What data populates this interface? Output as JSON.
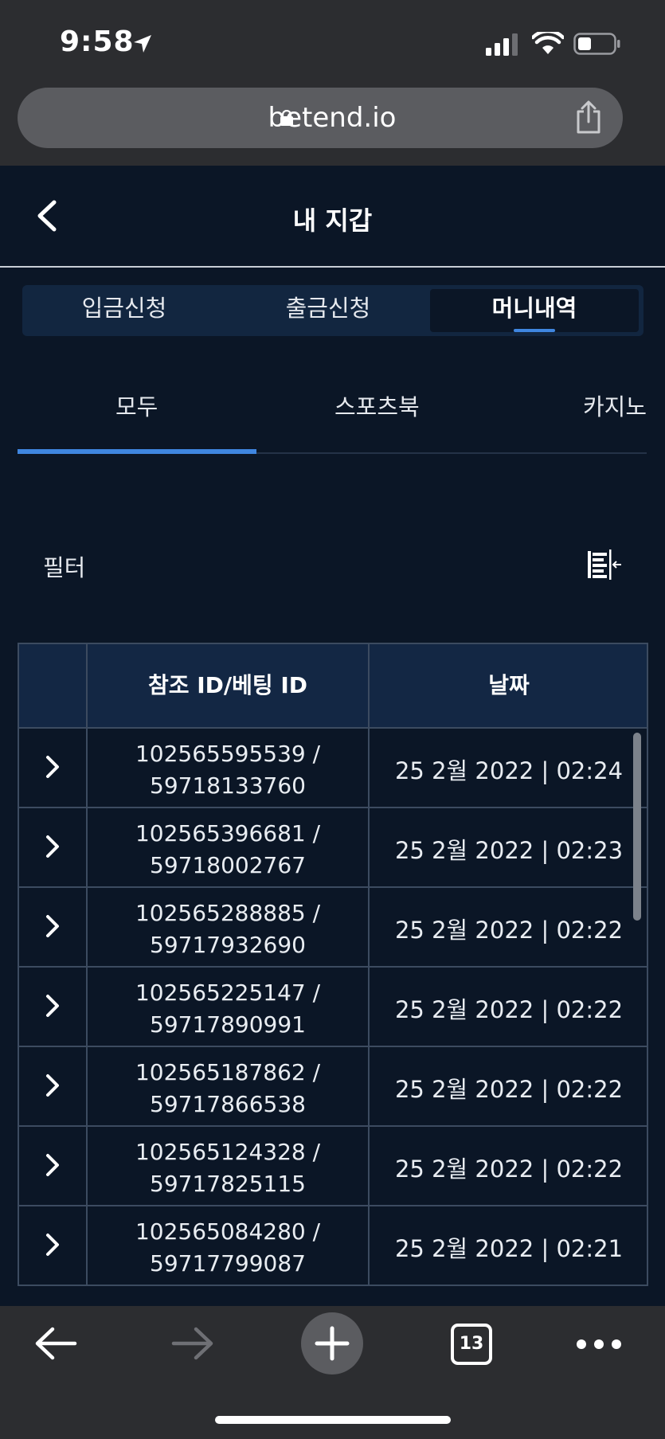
{
  "status_bar": {
    "time": "9:58"
  },
  "browser": {
    "url": "betend.io",
    "tab_count": "13"
  },
  "header": {
    "title": "내 지갑"
  },
  "tabs": [
    {
      "label": "입금신청",
      "active": false
    },
    {
      "label": "출금신청",
      "active": false
    },
    {
      "label": "머니내역",
      "active": true
    }
  ],
  "subtabs": [
    {
      "label": "모두",
      "active": true
    },
    {
      "label": "스포츠북",
      "active": false
    },
    {
      "label": "카지노",
      "active": false
    }
  ],
  "filter": {
    "label": "필터"
  },
  "table": {
    "columns": [
      "",
      "참조 ID/베팅 ID",
      "날짜"
    ],
    "rows": [
      {
        "ref": "102565595539 /",
        "bet": "59718133760",
        "date": "25 2월 2022 | 02:24"
      },
      {
        "ref": "102565396681 /",
        "bet": "59718002767",
        "date": "25 2월 2022 | 02:23"
      },
      {
        "ref": "102565288885 /",
        "bet": "59717932690",
        "date": "25 2월 2022 | 02:22"
      },
      {
        "ref": "102565225147 /",
        "bet": "59717890991",
        "date": "25 2월 2022 | 02:22"
      },
      {
        "ref": "102565187862 /",
        "bet": "59717866538",
        "date": "25 2월 2022 | 02:22"
      },
      {
        "ref": "102565124328 /",
        "bet": "59717825115",
        "date": "25 2월 2022 | 02:22"
      },
      {
        "ref": "102565084280 /",
        "bet": "59717799087",
        "date": "25 2월 2022 | 02:21"
      }
    ]
  },
  "colors": {
    "accent": "#3f86e0",
    "background": "#0b1626",
    "header_bg": "#132744"
  }
}
